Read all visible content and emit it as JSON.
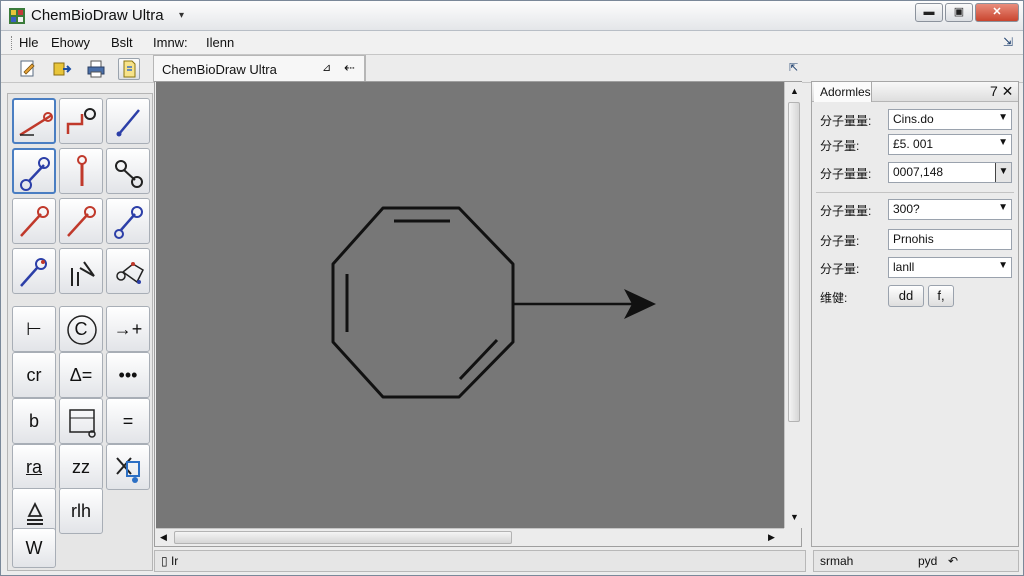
{
  "window": {
    "title": "ChemBioDraw Ultra",
    "title_caret": "▾",
    "controls": {
      "minimize": "▬",
      "maximize": "▣",
      "close": "✕"
    }
  },
  "menu": {
    "items": [
      "Hle",
      "Ehowy",
      "Bslt",
      "Imnw:",
      "Ilenn"
    ],
    "pin": "⇲"
  },
  "toolbar": {
    "icons": [
      "edit-doc-icon",
      "move-icon",
      "print-icon",
      "open-doc-icon"
    ],
    "doc_tab": {
      "label": "ChemBioDraw Ultra",
      "pin": "⊿",
      "back": "⇠"
    },
    "panel_pin": "⇱"
  },
  "palette": {
    "text_tools": [
      "⊢",
      "C",
      "→+",
      "cr",
      "Δ=",
      "•••",
      "b",
      "",
      "=",
      "ra",
      "zz",
      "",
      "",
      "rlh",
      "W"
    ]
  },
  "canvas": {
    "status_text": "▯ Ir"
  },
  "properties": {
    "title": "Adormles",
    "control": "7 ✕",
    "rows": [
      {
        "label": "分子量量:",
        "value": "Cins.do"
      },
      {
        "label": "分子量:",
        "value": "£5. 001"
      },
      {
        "label": "分子量量:",
        "value": "0007,148"
      },
      {
        "label": "分子量量:",
        "value": "300?"
      },
      {
        "label": "分子量:",
        "value": "Prnohis"
      },
      {
        "label": "分子量:",
        "value": "lanll"
      }
    ],
    "action_label": "维健:",
    "action_buttons": [
      "dd",
      "f,"
    ],
    "status_left": "srmah",
    "status_right": "pyd"
  },
  "colors": {
    "canvas_bg": "#777777",
    "structure": "#111111",
    "tool_red": "#c0392b",
    "tool_blue": "#2c3fa8"
  }
}
